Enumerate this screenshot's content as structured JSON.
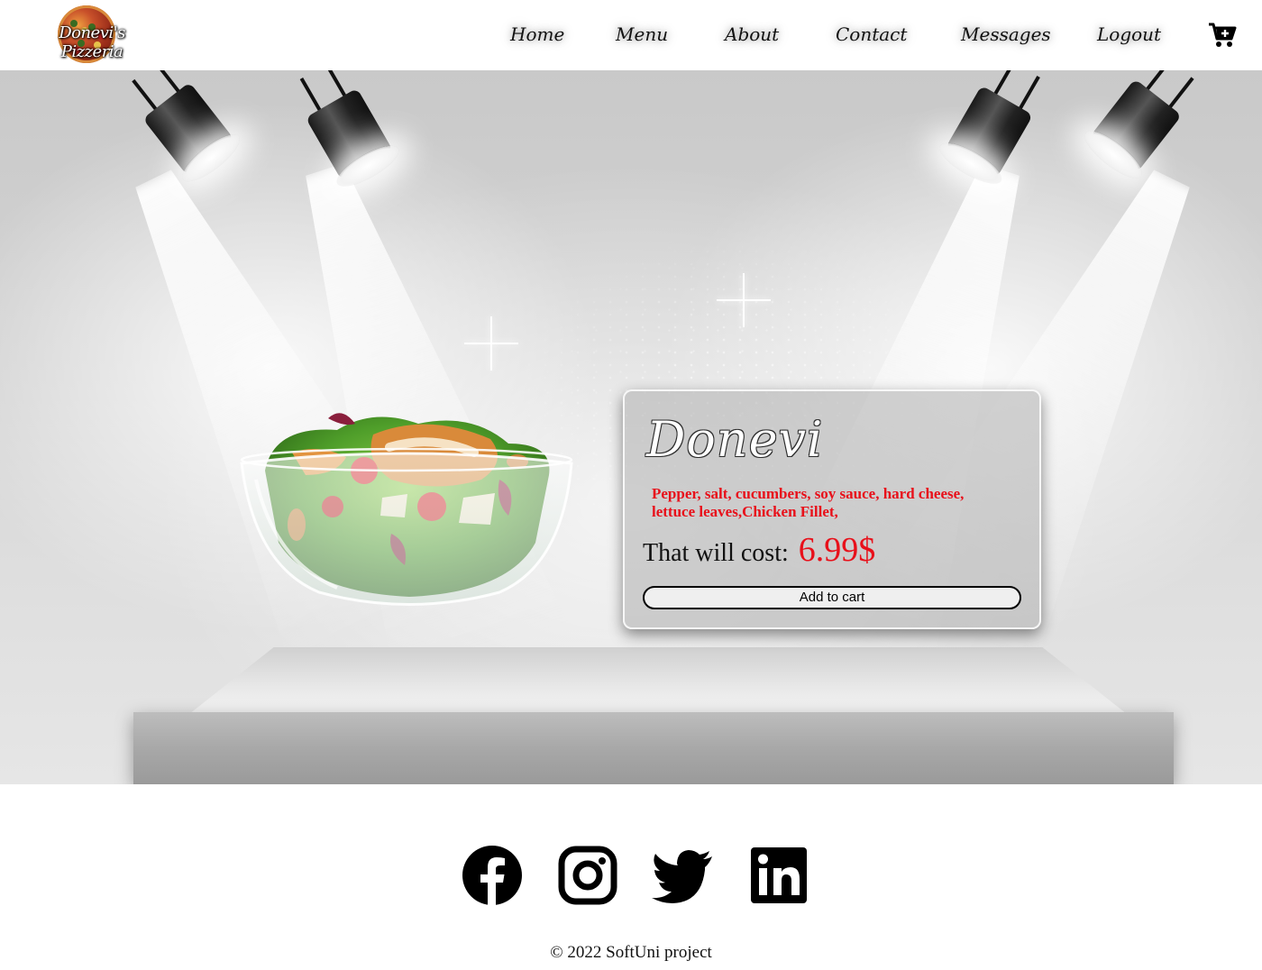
{
  "brand": {
    "name": "Donevi's Pizzeria"
  },
  "nav": {
    "home": "Home",
    "menu": "Menu",
    "about": "About",
    "contact": "Contact",
    "messages": "Messages",
    "logout": "Logout",
    "cart_icon": "cart-plus-icon"
  },
  "product": {
    "name": "Donevi",
    "ingredients": "Pepper, salt, cucumbers, soy sauce, hard cheese, lettuce leaves,Chicken Fillet,",
    "cost_label": "That will cost:",
    "price": "6.99$",
    "add_button": "Add to cart",
    "image": "salad-bowl"
  },
  "footer": {
    "socials": [
      "facebook-icon",
      "instagram-icon",
      "twitter-icon",
      "linkedin-icon"
    ],
    "copyright": "© 2022 SoftUni project"
  },
  "colors": {
    "accent_red": "#e8101a",
    "text_dark": "#111111",
    "background": "#ffffff"
  }
}
